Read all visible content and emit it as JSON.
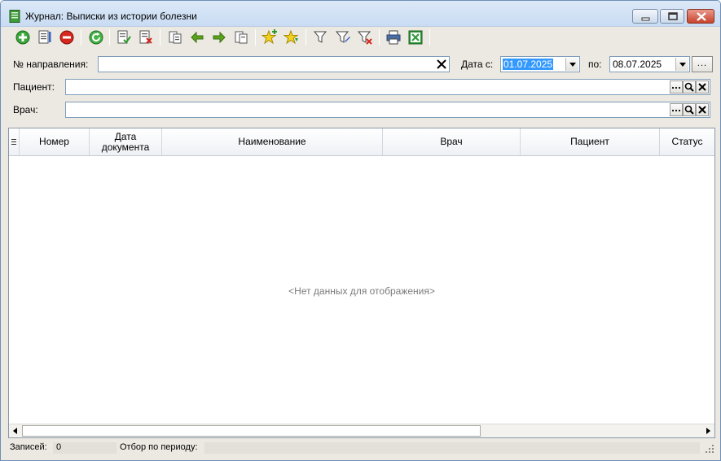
{
  "window": {
    "title": "Журнал: Выписки из истории болезни",
    "min_icon": "minimize-icon",
    "max_icon": "maximize-icon",
    "close_icon": "close-icon"
  },
  "toolbar": {
    "icons": [
      "add-icon",
      "edit-icon",
      "delete-icon",
      "refresh-icon",
      "approve-icon",
      "cancel-doc-icon",
      "copy-icon",
      "arrow-left-icon",
      "arrow-right-icon",
      "copy-right-icon",
      "favorite-add-icon",
      "favorite-down-icon",
      "filter-icon",
      "filter-edit-icon",
      "filter-clear-icon",
      "print-icon",
      "excel-icon"
    ]
  },
  "filters": {
    "referral_label": "№ направления:",
    "referral_value": "",
    "date_from_label": "Дата с:",
    "date_from_value": "01.07.2025",
    "date_to_label": "по:",
    "date_to_value": "08.07.2025",
    "dots_label": "...",
    "patient_label": "Пациент:",
    "patient_value": "",
    "doctor_label": "Врач:",
    "doctor_value": ""
  },
  "grid": {
    "columns": [
      "Номер",
      "Дата документа",
      "Наименование",
      "Врач",
      "Пациент",
      "Статус"
    ],
    "empty_text": "<Нет данных для отображения>"
  },
  "status": {
    "records_label": "Записей:",
    "records_value": "0",
    "period_label": "Отбор по периоду:",
    "period_value": ""
  },
  "colors": {
    "selection": "#3399ff",
    "window_bg": "#ece9e2",
    "title_bg": "#dbe8f7"
  }
}
